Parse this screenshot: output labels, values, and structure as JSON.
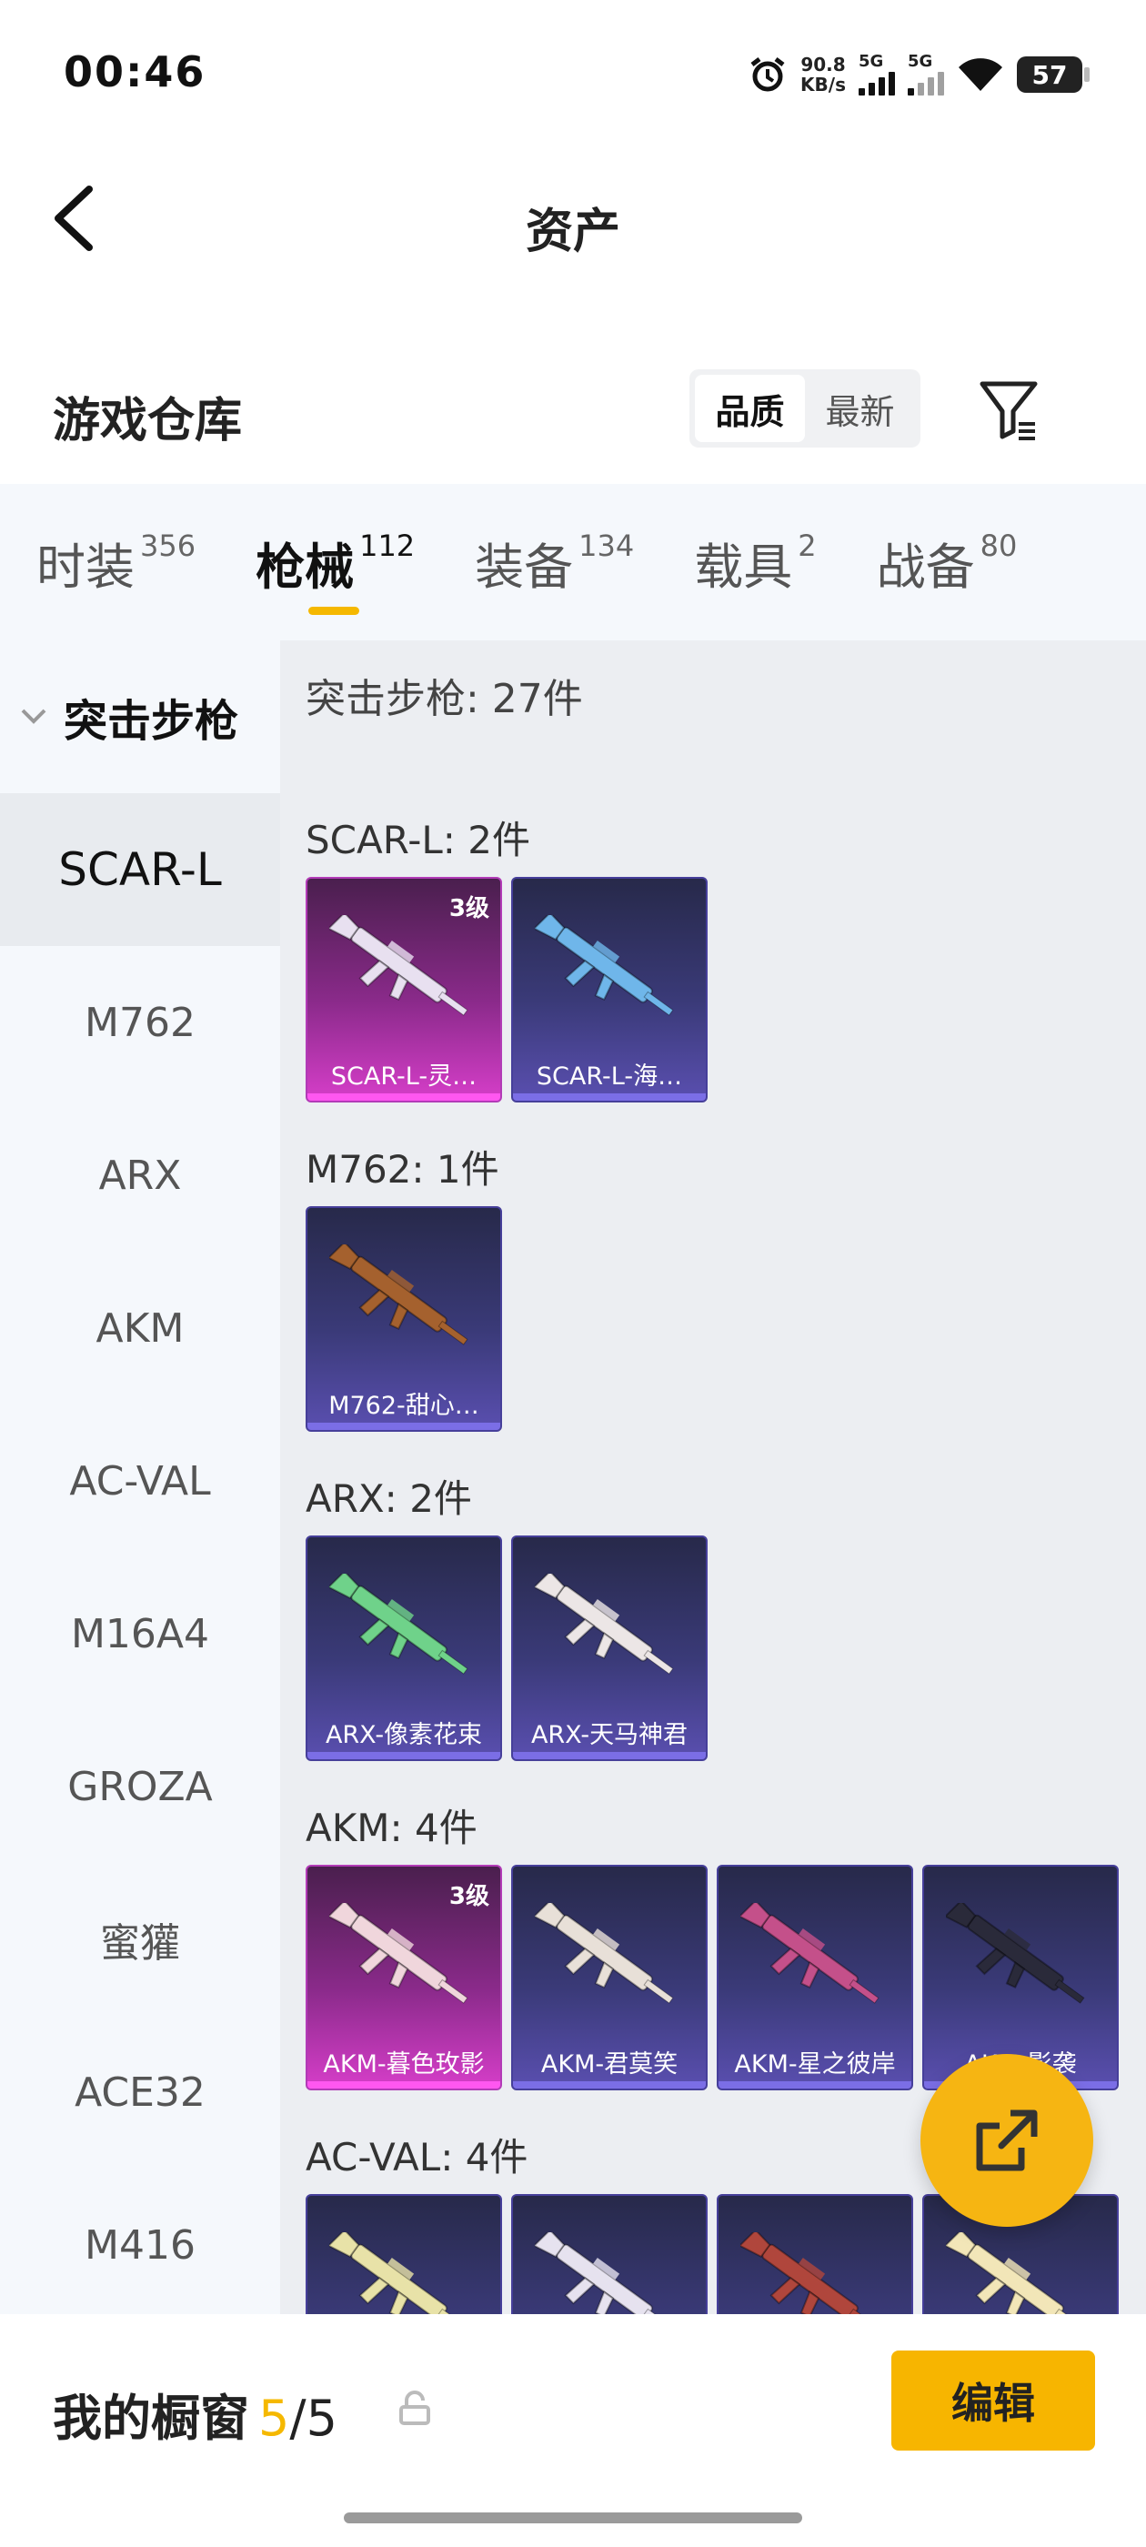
{
  "status": {
    "time": "00:46",
    "speed": "90.8",
    "speed_unit": "KB/s",
    "sig1": "5G",
    "sig2": "5G",
    "battery": "57"
  },
  "nav": {
    "title": "资产"
  },
  "warehouse": {
    "title": "游戏仓库",
    "sort_quality": "品质",
    "sort_latest": "最新"
  },
  "tabs": [
    {
      "label": "时装",
      "count": "356"
    },
    {
      "label": "枪械",
      "count": "112"
    },
    {
      "label": "装备",
      "count": "134"
    },
    {
      "label": "载具",
      "count": "2"
    },
    {
      "label": "战备",
      "count": "80"
    }
  ],
  "sidebar": {
    "header": "突击步枪",
    "items": [
      "SCAR-L",
      "M762",
      "ARX",
      "AKM",
      "AC-VAL",
      "M16A4",
      "GROZA",
      "蜜獾",
      "ACE32",
      "M416"
    ]
  },
  "main": {
    "title": "突击步枪: 27件",
    "groups": [
      {
        "title": "SCAR-L: 2件",
        "items": [
          {
            "name": "SCAR-L-灵…",
            "level": "3级",
            "quality": "pink",
            "gun": "#e8e0f0"
          },
          {
            "name": "SCAR-L-海…",
            "level": "",
            "quality": "purple",
            "gun": "#6fb6ea"
          }
        ]
      },
      {
        "title": "M762: 1件",
        "items": [
          {
            "name": "M762-甜心…",
            "level": "",
            "quality": "purple",
            "gun": "#a5612e"
          }
        ]
      },
      {
        "title": "ARX: 2件",
        "items": [
          {
            "name": "ARX-像素花束",
            "level": "",
            "quality": "purple",
            "gun": "#6fd28a"
          },
          {
            "name": "ARX-天马神君",
            "level": "",
            "quality": "purple",
            "gun": "#ece6e6"
          }
        ]
      },
      {
        "title": "AKM: 4件",
        "items": [
          {
            "name": "AKM-暮色玫影",
            "level": "3级",
            "quality": "pink",
            "gun": "#f0d6dc"
          },
          {
            "name": "AKM-君莫笑",
            "level": "",
            "quality": "purple",
            "gun": "#e8e0d8"
          },
          {
            "name": "AKM-星之彼岸",
            "level": "",
            "quality": "purple",
            "gun": "#c4508a"
          },
          {
            "name": "AKM-影袭",
            "level": "",
            "quality": "purple",
            "gun": "#2a2a3a"
          }
        ]
      },
      {
        "title": "AC-VAL: 4件",
        "items": [
          {
            "name": "",
            "level": "",
            "quality": "purple",
            "gun": "#e8e2a8"
          },
          {
            "name": "",
            "level": "",
            "quality": "purple",
            "gun": "#e6e2ef"
          },
          {
            "name": "",
            "level": "",
            "quality": "purple",
            "gun": "#b0463c"
          },
          {
            "name": "",
            "level": "",
            "quality": "purple",
            "gun": "#f2e6b8"
          }
        ]
      }
    ]
  },
  "bottom": {
    "title": "我的橱窗",
    "count_current": "5",
    "count_sep": "/",
    "count_total": "5",
    "edit_label": "编辑"
  },
  "colors": {
    "accent": "#f5b800",
    "fab": "#f6b512"
  }
}
